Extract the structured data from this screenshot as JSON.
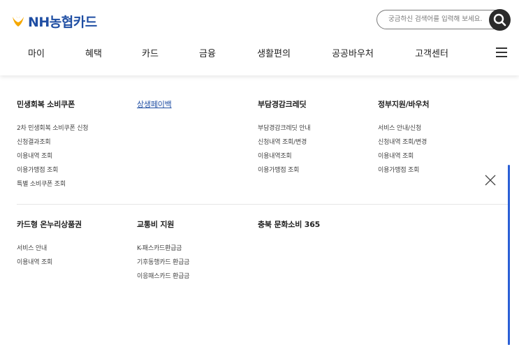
{
  "brand": {
    "logo_text": "NH농협카드",
    "logo_color": "#1f4ea3",
    "accent": "#f5a800"
  },
  "search": {
    "placeholder": "궁금하신 검색어를 입력해 보세요.",
    "icon": "search-icon"
  },
  "nav": {
    "items": [
      "마이",
      "혜택",
      "카드",
      "금융",
      "생활편의",
      "공공바우처",
      "고객센터"
    ],
    "menu_icon": "hamburger-icon"
  },
  "columns": [
    {
      "title": "민생회복 소비쿠폰",
      "active": false,
      "links": [
        "2차 민생회복 소비쿠폰 신청",
        "신청결과조회",
        "이용내역 조회",
        "이용가맹점 조회",
        "특별 소비쿠폰 조회"
      ]
    },
    {
      "title": "상생페이백",
      "active": true,
      "links": []
    },
    {
      "title": "부담경감크레딧",
      "active": false,
      "links": [
        "부담경감크레딧 안내",
        "신청내역 조회/변경",
        "이용내역조회",
        "이용가맹점 조회"
      ]
    },
    {
      "title": "정부지원/바우처",
      "active": false,
      "links": [
        "서비스 안내/신청",
        "신청내역 조회/변경",
        "이용내역 조회",
        "이용가맹점 조회"
      ]
    },
    {
      "title": "카드형 온누리상품권",
      "active": false,
      "links": [
        "서비스 안내",
        "이용내역 조회"
      ]
    },
    {
      "title": "교통비 지원",
      "active": false,
      "links": [
        "K-패스카드환급금",
        "기후동행카드 환급금",
        "이응패스카드 환급금"
      ]
    },
    {
      "title": "충북 문화소비 365",
      "active": false,
      "links": []
    }
  ],
  "close_icon": "close-icon"
}
